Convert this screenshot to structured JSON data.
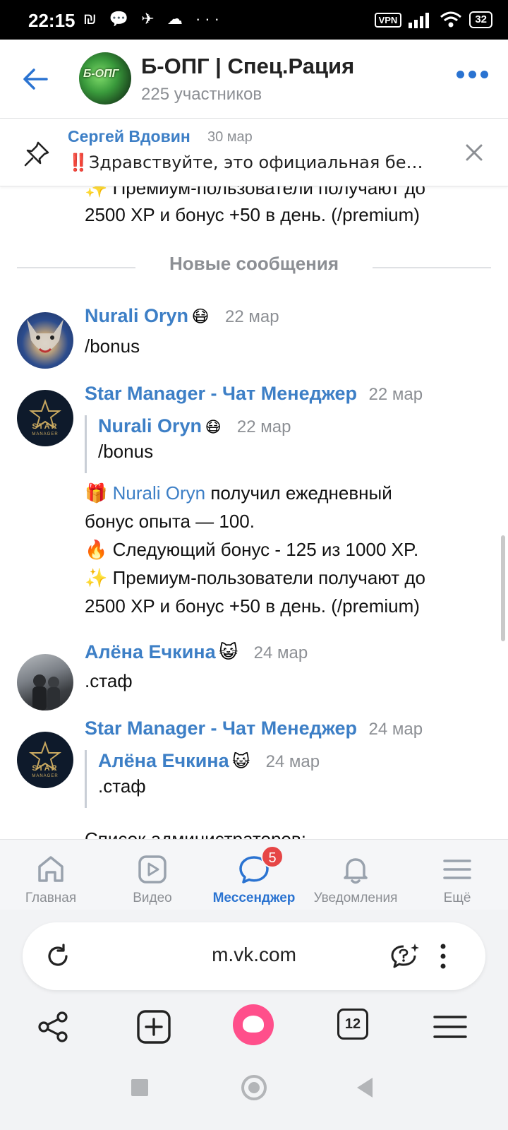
{
  "status_bar": {
    "time": "22:15",
    "left_icons": "₪ 💬 ✈ ☁ ···",
    "vpn": "VPN",
    "battery": "32"
  },
  "header": {
    "avatar_text": "Б-ОПГ",
    "title": "Б-ОПГ | Спец.Рация",
    "subtitle": "225 участников"
  },
  "pinned": {
    "author": "Сергей Вдовин",
    "date": "30 мар",
    "text": "‼️Здравствуйте, это официальная бе…"
  },
  "feed": {
    "top_partial": {
      "line1": "✨ Премиум-пользователи получают до",
      "line2": "2500 XP и бонус +50 в день. (/premium)"
    },
    "divider_label": "Новые сообщения",
    "messages": [
      {
        "author": "Nurali Oryn",
        "author_emoji": "😷",
        "date": "22 мар",
        "text": "/bonus"
      },
      {
        "author": "Star Manager - Чат Менеджер",
        "date": "22 мар",
        "avatar_line1": "STAR",
        "avatar_line2": "MANAGER",
        "quote": {
          "author": "Nurali Oryn",
          "author_emoji": "😷",
          "date": "22 мар",
          "text": "/bonus"
        },
        "body": {
          "l1_emoji": "🎁",
          "l1_mention": "Nurali Oryn",
          "l1_text": " получил ежедневный",
          "l2": "бонус опыта — 100.",
          "l3": "🔥 Следующий бонус - 125 из 1000 XP.",
          "l4": "✨ Премиум-пользователи получают до",
          "l5": "2500 XP и бонус +50 в день. (/premium)"
        }
      },
      {
        "author": "Алёна Ечкина",
        "author_emoji": "😺",
        "date": "24 мар",
        "text": ".стаф"
      },
      {
        "author": "Star Manager - Чат Менеджер",
        "date": "24 мар",
        "avatar_line1": "STAR",
        "avatar_line2": "MANAGER",
        "quote": {
          "author": "Алёна Ечкина",
          "author_emoji": "😺",
          "date": "24 мар",
          "text": ".стаф"
        },
        "partial_text": "Список администраторов:"
      }
    ]
  },
  "tabbar": {
    "items": [
      {
        "label": "Главная",
        "icon": "home-icon"
      },
      {
        "label": "Видео",
        "icon": "video-icon"
      },
      {
        "label": "Мессенджер",
        "icon": "messenger-icon",
        "badge": "5",
        "active": true
      },
      {
        "label": "Уведомления",
        "icon": "bell-icon"
      },
      {
        "label": "Ещё",
        "icon": "menu-icon"
      }
    ],
    "accent": "#2a73d1",
    "badge_color": "#e64646"
  },
  "browser": {
    "url": "m.vk.com",
    "tabs_count": "12",
    "alice_color": "#ff4f8b"
  }
}
